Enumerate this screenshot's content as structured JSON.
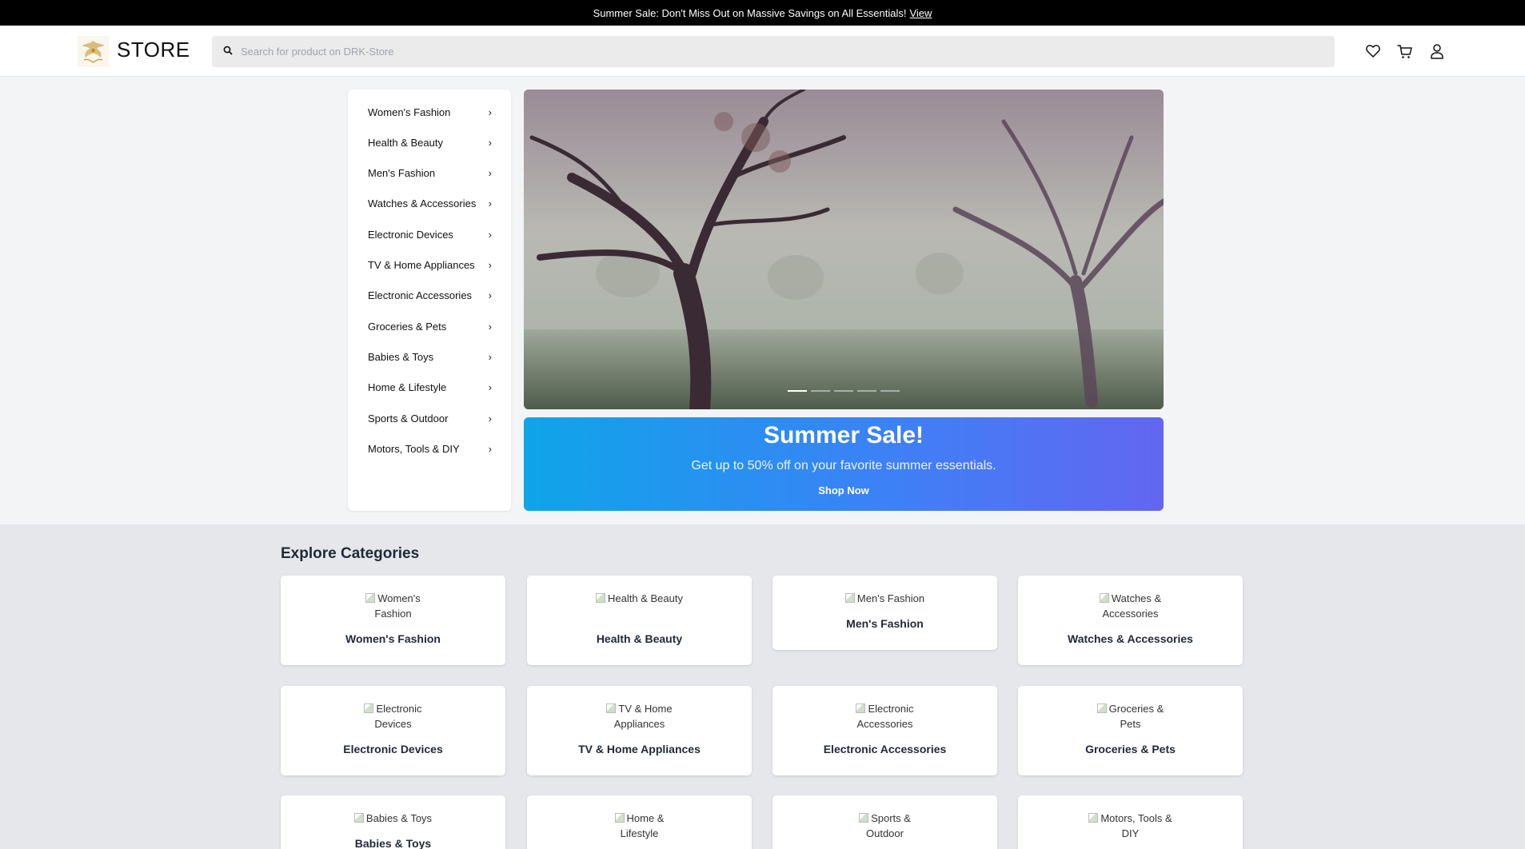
{
  "announcement": {
    "text": "Summer Sale: Don't Miss Out on Massive Savings on All Essentials!",
    "link": "View"
  },
  "header": {
    "brand": "STORE",
    "search_placeholder": "Search for product on DRK-Store",
    "icons": [
      "heart-icon",
      "cart-icon",
      "user-icon"
    ]
  },
  "sidebar": {
    "items": [
      "Women's Fashion",
      "Health & Beauty",
      "Men's Fashion",
      "Watches & Accessories",
      "Electronic Devices",
      "TV & Home Appliances",
      "Electronic Accessories",
      "Groceries & Pets",
      "Babies & Toys",
      "Home & Lifestyle",
      "Sports & Outdoor",
      "Motors, Tools & DIY"
    ]
  },
  "carousel": {
    "slide_count": 5,
    "active_index": 0
  },
  "promo": {
    "title": "Summer Sale!",
    "subtitle": "Get up to 50% off on your favorite summer essentials.",
    "cta": "Shop Now",
    "gradient": [
      "#0ea5e9",
      "#6366f1"
    ]
  },
  "categories": {
    "title": "Explore Categories",
    "items": [
      {
        "alt": "Women's Fashion",
        "name": "Women's Fashion"
      },
      {
        "alt": "Health & Beauty",
        "name": "Health & Beauty"
      },
      {
        "alt": "Men's Fashion",
        "name": "Men's Fashion"
      },
      {
        "alt": "Watches & Accessories",
        "name": "Watches & Accessories"
      },
      {
        "alt": "Electronic Devices",
        "name": "Electronic Devices"
      },
      {
        "alt": "TV & Home Appliances",
        "name": "TV & Home Appliances"
      },
      {
        "alt": "Electronic Accessories",
        "name": "Electronic Accessories"
      },
      {
        "alt": "Groceries & Pets",
        "name": "Groceries & Pets"
      },
      {
        "alt": "Babies & Toys",
        "name": "Babies & Toys"
      },
      {
        "alt": "Home & Lifestyle",
        "name": ""
      },
      {
        "alt": "Sports & Outdoor",
        "name": ""
      },
      {
        "alt": "Motors, Tools & DIY",
        "name": ""
      }
    ]
  }
}
